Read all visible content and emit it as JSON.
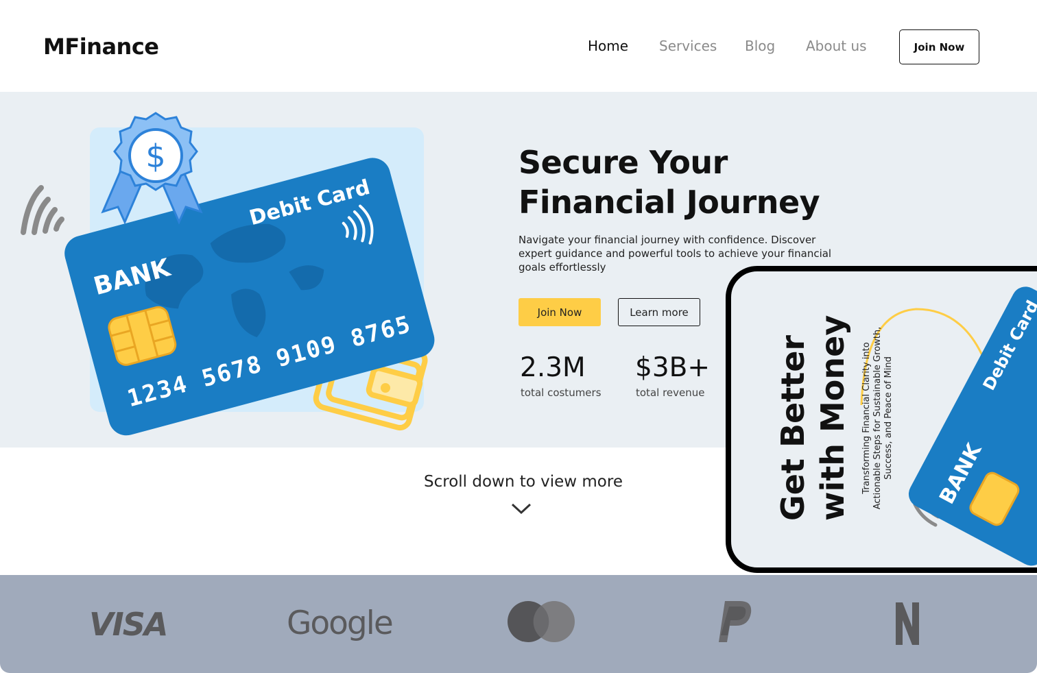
{
  "header": {
    "logo": "MFinance",
    "nav": [
      {
        "label": "Home",
        "active": true
      },
      {
        "label": "Services",
        "active": false
      },
      {
        "label": "Blog",
        "active": false
      },
      {
        "label": "About us",
        "active": false
      }
    ],
    "join_label": "Join Now"
  },
  "hero": {
    "title_line1": "Secure Your",
    "title_line2": "Financial Journey",
    "subtitle": "Navigate your financial journey with confidence. Discover expert guidance and powerful tools to achieve your financial goals effortlessly",
    "primary_button": "Join Now",
    "secondary_button": "Learn more",
    "stats": [
      {
        "value": "2.3M",
        "label": "total costumers"
      },
      {
        "value": "$3B+",
        "label": "total revenue"
      }
    ],
    "card": {
      "bank_text": "BANK",
      "type_text": "Debit Card",
      "number": "1234 5678 9109 8765",
      "badge_symbol": "$"
    }
  },
  "scroll": {
    "text": "Scroll down to view more",
    "icon": "chevron-down-icon"
  },
  "phone": {
    "headline_line1": "Get Better",
    "headline_line2": "with Money",
    "subtitle": "Transforming Financial Clarity into Actionable Steps for Sustainable Growth, Success, and Peace of Mind",
    "card_bank_text": "BANK",
    "card_type_text": "Debit Card"
  },
  "brands": [
    {
      "name": "VISA",
      "icon": "visa-logo"
    },
    {
      "name": "Google",
      "icon": "google-logo"
    },
    {
      "name": "Mastercard",
      "icon": "mastercard-logo"
    },
    {
      "name": "PayPal",
      "icon": "paypal-logo"
    },
    {
      "name": "Netflix",
      "icon": "netflix-logo"
    }
  ],
  "colors": {
    "accent": "#fecd46",
    "hero_bg": "#eaeff3",
    "card_blue": "#1a7dc4",
    "brands_bg": "#a0aabb",
    "brand_logo": "#5a5a5c"
  }
}
